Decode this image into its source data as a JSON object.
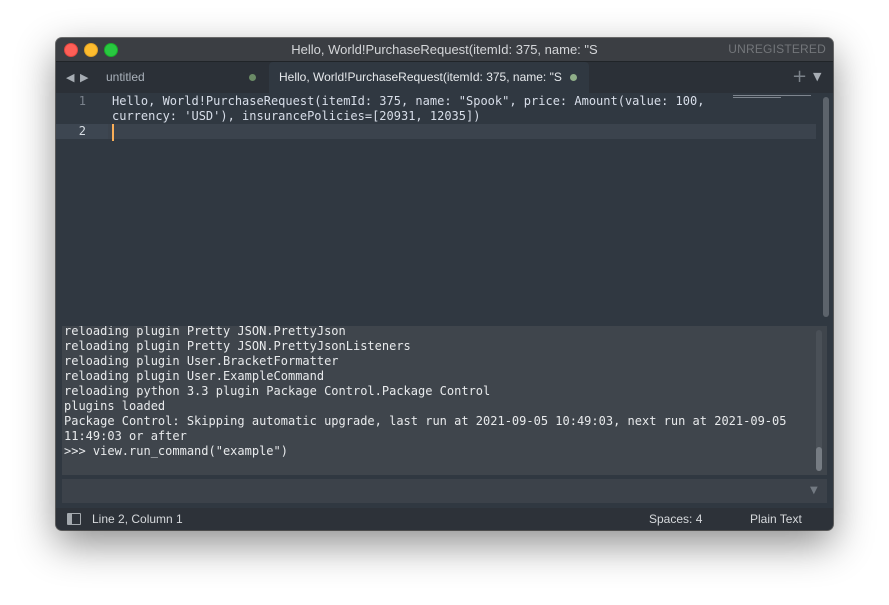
{
  "window": {
    "title": "Hello, World!PurchaseRequest(itemId: 375, name: \"S",
    "license_label": "UNREGISTERED"
  },
  "tabs": {
    "nav_left_icon": "triangle-left-icon",
    "nav_right_icon": "triangle-right-icon",
    "items": [
      {
        "label": "untitled",
        "active": false,
        "dirty": true
      },
      {
        "label": "Hello, World!PurchaseRequest(itemId: 375, name: \"S",
        "active": true,
        "dirty": true
      }
    ],
    "new_tab_glyph": "+",
    "menu_glyph": "▼"
  },
  "editor": {
    "line_numbers": [
      "1",
      "2"
    ],
    "lines": [
      "Hello, World!PurchaseRequest(itemId: 375, name: \"Spook\", price: Amount(value: 100,",
      "currency: 'USD'), insurancePolicies=[20931, 12035])"
    ],
    "current_line": 2
  },
  "console": {
    "lines": [
      "reloading plugin Pretty JSON.PrettyJson",
      "reloading plugin Pretty JSON.PrettyJsonListeners",
      "reloading plugin User.BracketFormatter",
      "reloading plugin User.ExampleCommand",
      "reloading python 3.3 plugin Package Control.Package Control",
      "plugins loaded",
      "Package Control: Skipping automatic upgrade, last run at 2021-09-05 10:49:03, next run at 2021-09-05",
      "11:49:03 or after",
      ">>> view.run_command(\"example\")"
    ],
    "input_value": "",
    "input_arrow": "▼"
  },
  "statusbar": {
    "position": "Line 2, Column 1",
    "indentation": "Spaces: 4",
    "syntax": "Plain Text"
  },
  "colors": {
    "background": "#303841",
    "caret": "#f9ae58",
    "dirty_dot": "#8fae88"
  }
}
